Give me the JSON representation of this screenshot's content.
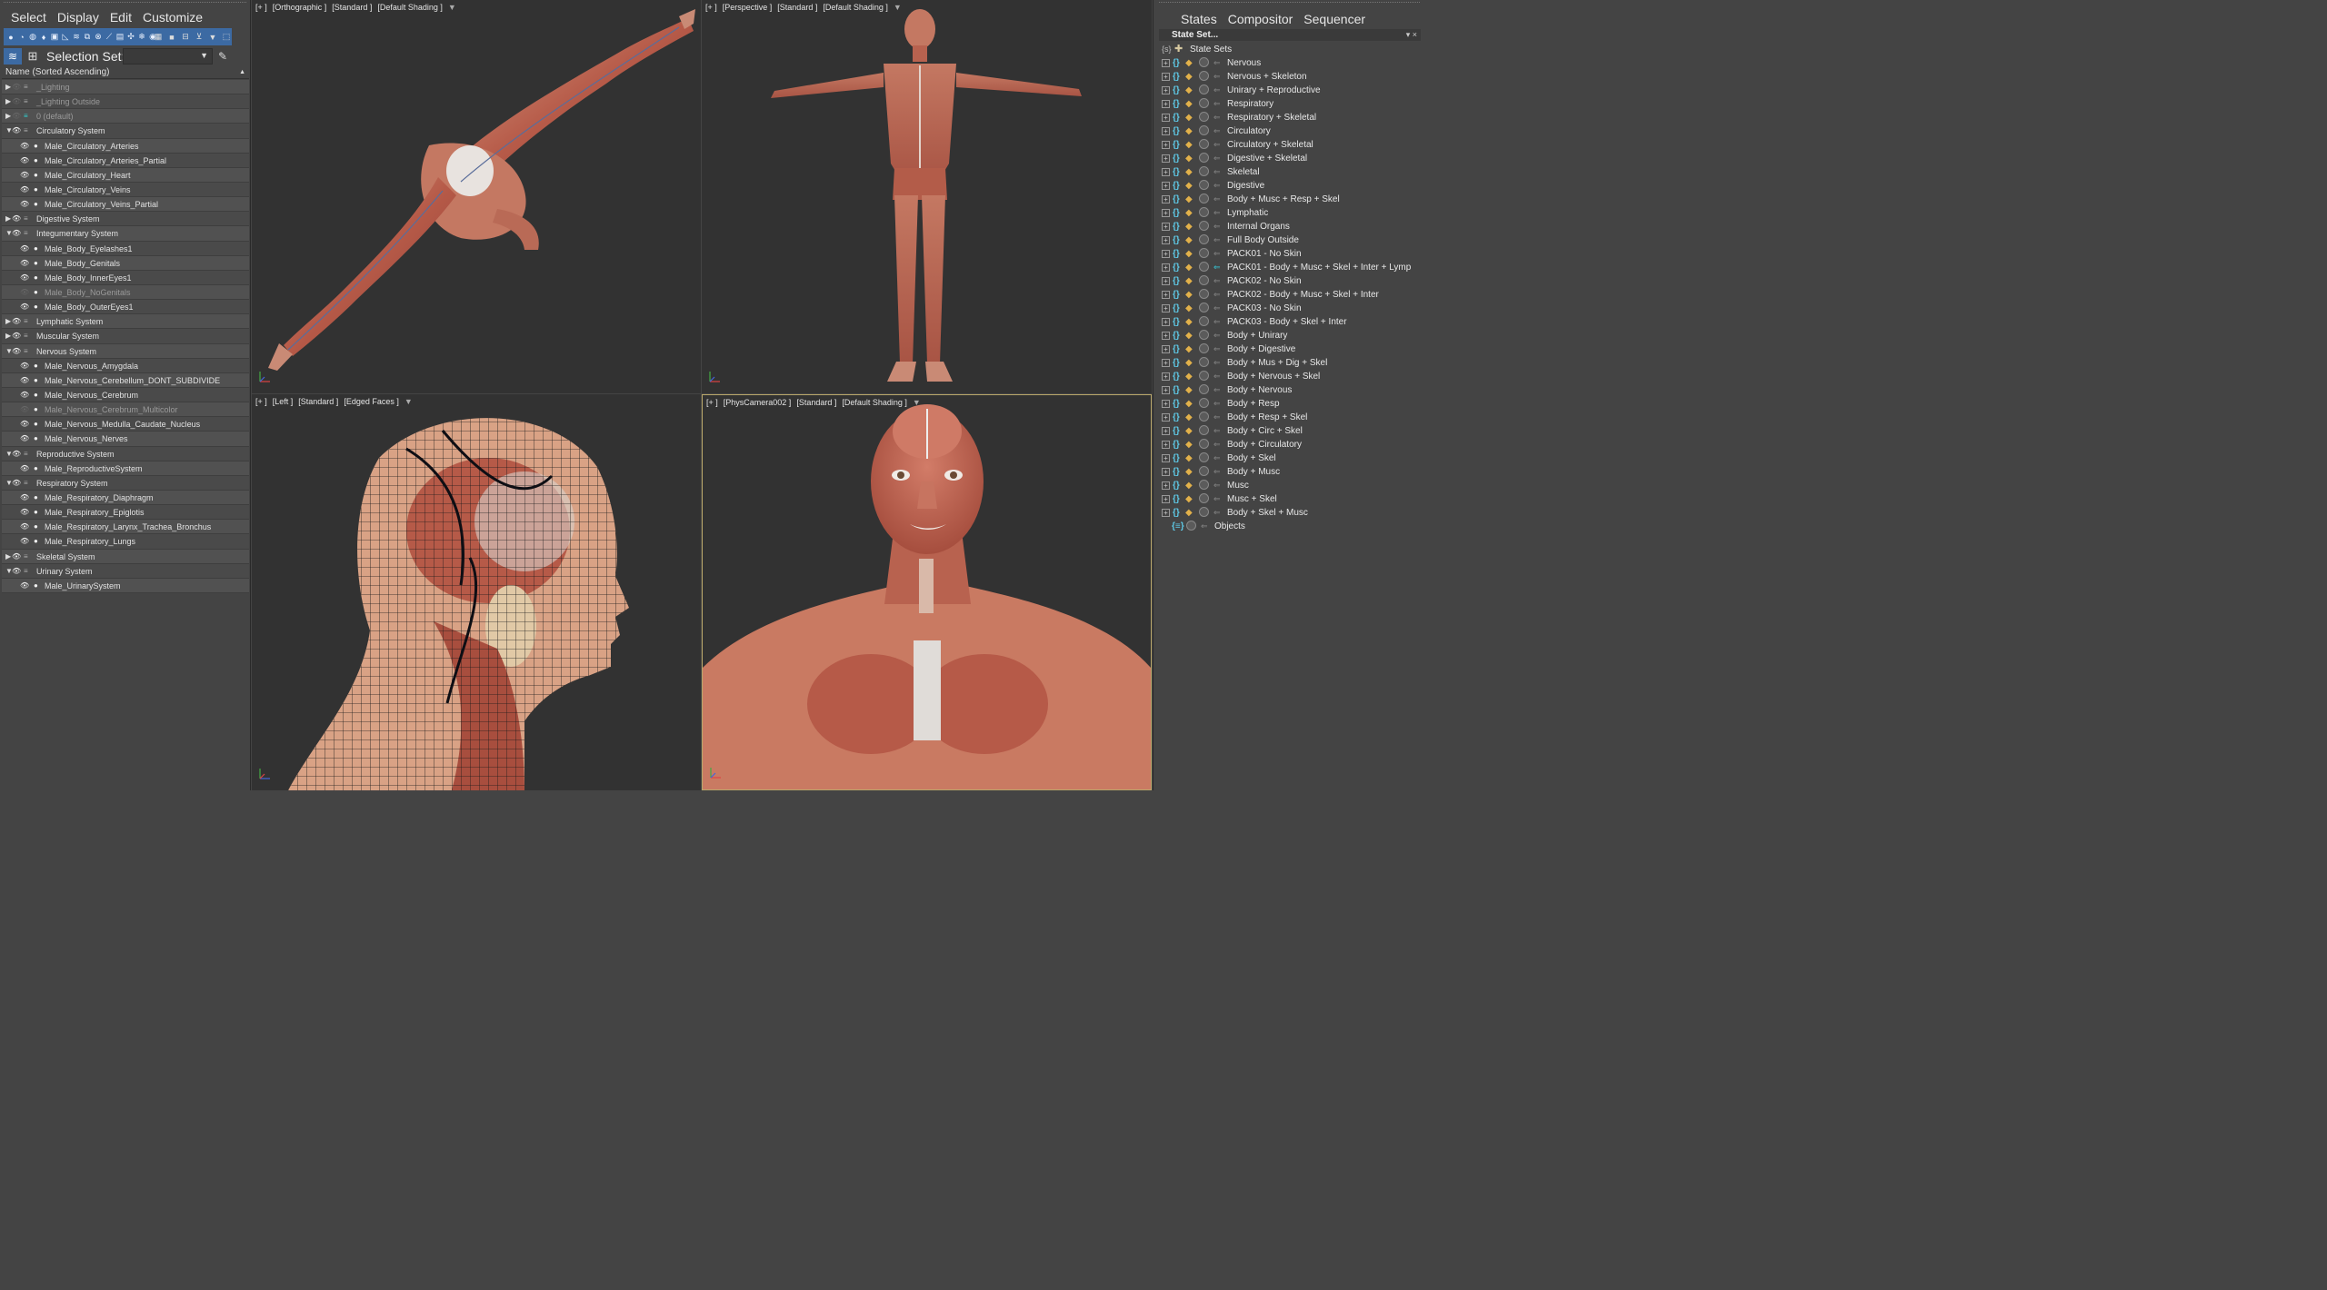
{
  "scene_explorer": {
    "menu": [
      "Select",
      "Display",
      "Edit",
      "Customize"
    ],
    "selection_set_label": "Selection Set:",
    "selection_set_value": "",
    "column_header": "Name (Sorted Ascending)",
    "rows": [
      {
        "label": "_Lighting",
        "level": 0,
        "expand": "collapsed",
        "visible": false,
        "dim": true,
        "layer_active": false
      },
      {
        "label": "_Lighting Outside",
        "level": 0,
        "expand": "collapsed",
        "visible": false,
        "dim": true,
        "layer_active": false
      },
      {
        "label": "0 (default)",
        "level": 0,
        "expand": "collapsed",
        "visible": false,
        "dim": true,
        "layer_active": true
      },
      {
        "label": "Circulatory System",
        "level": 0,
        "expand": "expanded",
        "visible": true,
        "dim": false
      },
      {
        "label": "Male_Circulatory_Arteries",
        "level": 1,
        "visible": true,
        "dim": false
      },
      {
        "label": "Male_Circulatory_Arteries_Partial",
        "level": 1,
        "visible": true,
        "dim": false
      },
      {
        "label": "Male_Circulatory_Heart",
        "level": 1,
        "visible": true,
        "dim": false
      },
      {
        "label": "Male_Circulatory_Veins",
        "level": 1,
        "visible": true,
        "dim": false
      },
      {
        "label": "Male_Circulatory_Veins_Partial",
        "level": 1,
        "visible": true,
        "dim": false
      },
      {
        "label": "Digestive System",
        "level": 0,
        "expand": "collapsed",
        "visible": true,
        "dim": false
      },
      {
        "label": "Integumentary System",
        "level": 0,
        "expand": "expanded",
        "visible": true,
        "dim": false
      },
      {
        "label": "Male_Body_Eyelashes1",
        "level": 1,
        "visible": true,
        "dim": false
      },
      {
        "label": "Male_Body_Genitals",
        "level": 1,
        "visible": true,
        "dim": false
      },
      {
        "label": "Male_Body_InnerEyes1",
        "level": 1,
        "visible": true,
        "dim": false
      },
      {
        "label": "Male_Body_NoGenitals",
        "level": 1,
        "visible": false,
        "dim": true
      },
      {
        "label": "Male_Body_OuterEyes1",
        "level": 1,
        "visible": true,
        "dim": false
      },
      {
        "label": "Lymphatic System",
        "level": 0,
        "expand": "collapsed",
        "visible": true,
        "dim": false
      },
      {
        "label": "Muscular System",
        "level": 0,
        "expand": "collapsed",
        "visible": true,
        "dim": false
      },
      {
        "label": "Nervous System",
        "level": 0,
        "expand": "expanded",
        "visible": true,
        "dim": false
      },
      {
        "label": "Male_Nervous_Amygdala",
        "level": 1,
        "visible": true,
        "dim": false
      },
      {
        "label": "Male_Nervous_Cerebellum_DONT_SUBDIVIDE",
        "level": 1,
        "visible": true,
        "dim": false
      },
      {
        "label": "Male_Nervous_Cerebrum",
        "level": 1,
        "visible": true,
        "dim": false
      },
      {
        "label": "Male_Nervous_Cerebrum_Multicolor",
        "level": 1,
        "visible": false,
        "dim": true
      },
      {
        "label": "Male_Nervous_Medulla_Caudate_Nucleus",
        "level": 1,
        "visible": true,
        "dim": false
      },
      {
        "label": "Male_Nervous_Nerves",
        "level": 1,
        "visible": true,
        "dim": false
      },
      {
        "label": "Reproductive System",
        "level": 0,
        "expand": "expanded",
        "visible": true,
        "dim": false
      },
      {
        "label": "Male_ReproductiveSystem",
        "level": 1,
        "visible": true,
        "dim": false
      },
      {
        "label": "Respiratory System",
        "level": 0,
        "expand": "expanded",
        "visible": true,
        "dim": false
      },
      {
        "label": "Male_Respiratory_Diaphragm",
        "level": 1,
        "visible": true,
        "dim": false
      },
      {
        "label": "Male_Respiratory_Epiglotis",
        "level": 1,
        "visible": true,
        "dim": false
      },
      {
        "label": "Male_Respiratory_Larynx_Trachea_Bronchus",
        "level": 1,
        "visible": true,
        "dim": false
      },
      {
        "label": "Male_Respiratory_Lungs",
        "level": 1,
        "visible": true,
        "dim": false
      },
      {
        "label": "Skeletal System",
        "level": 0,
        "expand": "collapsed",
        "visible": true,
        "dim": false
      },
      {
        "label": "Urinary System",
        "level": 0,
        "expand": "expanded",
        "visible": true,
        "dim": false
      },
      {
        "label": "Male_UrinarySystem",
        "level": 1,
        "visible": true,
        "dim": false
      }
    ]
  },
  "viewports": {
    "top_left": {
      "plus": "[+ ]",
      "view": "[Orthographic ]",
      "mode": "[Standard ]",
      "shading": "[Default Shading ]"
    },
    "top_right": {
      "plus": "[+ ]",
      "view": "[Perspective ]",
      "mode": "[Standard ]",
      "shading": "[Default Shading ]"
    },
    "bottom_left": {
      "plus": "[+ ]",
      "view": "[Left ]",
      "mode": "[Standard ]",
      "shading": "[Edged Faces ]"
    },
    "bottom_right": {
      "plus": "[+ ]",
      "view": "[PhysCamera002 ]",
      "mode": "[Standard ]",
      "shading": "[Default Shading ]"
    }
  },
  "state_sets": {
    "menu": [
      "States",
      "Compositor",
      "Sequencer"
    ],
    "header": "State Set...",
    "root_label": "State Sets",
    "items": [
      {
        "label": "Nervous",
        "active": false
      },
      {
        "label": "Nervous + Skeleton",
        "active": false
      },
      {
        "label": "Unirary + Reproductive",
        "active": false
      },
      {
        "label": "Respiratory",
        "active": false
      },
      {
        "label": "Respiratory + Skeletal",
        "active": false
      },
      {
        "label": "Circulatory",
        "active": false
      },
      {
        "label": "Circulatory + Skeletal",
        "active": false
      },
      {
        "label": "Digestive + Skeletal",
        "active": false
      },
      {
        "label": "Skeletal",
        "active": false
      },
      {
        "label": "Digestive",
        "active": false
      },
      {
        "label": "Body + Musc + Resp + Skel",
        "active": false
      },
      {
        "label": "Lymphatic",
        "active": false
      },
      {
        "label": "Internal Organs",
        "active": false
      },
      {
        "label": "Full Body Outside",
        "active": false
      },
      {
        "label": "PACK01 - No Skin",
        "active": false
      },
      {
        "label": "PACK01 - Body + Musc + Skel + Inter + Lymp",
        "active": true
      },
      {
        "label": "PACK02 - No Skin",
        "active": false
      },
      {
        "label": "PACK02 - Body + Musc + Skel + Inter",
        "active": false
      },
      {
        "label": "PACK03 - No Skin",
        "active": false
      },
      {
        "label": "PACK03 - Body + Skel + Inter",
        "active": false
      },
      {
        "label": "Body + Unirary",
        "active": false
      },
      {
        "label": "Body + Digestive",
        "active": false
      },
      {
        "label": "Body + Mus + Dig + Skel",
        "active": false
      },
      {
        "label": "Body + Nervous + Skel",
        "active": false
      },
      {
        "label": "Body + Nervous",
        "active": false
      },
      {
        "label": "Body + Resp",
        "active": false
      },
      {
        "label": "Body + Resp + Skel",
        "active": false
      },
      {
        "label": "Body + Circ + Skel",
        "active": false
      },
      {
        "label": "Body + Circulatory",
        "active": false
      },
      {
        "label": "Body + Skel",
        "active": false
      },
      {
        "label": "Body + Musc",
        "active": false
      },
      {
        "label": "Musc",
        "active": false
      },
      {
        "label": "Musc + Skel",
        "active": false
      },
      {
        "label": "Body + Skel + Musc",
        "active": false
      }
    ],
    "objects_label": "Objects"
  },
  "colors": {
    "panel_bg": "#444444",
    "viewport_bg": "#323232",
    "toolbar_accent": "#3c6aa3",
    "active_viewport_border": "#b9a76a",
    "muscle": "#b65a48",
    "skin": "#d9a285",
    "state_arrow_active": "#37c6d6"
  }
}
